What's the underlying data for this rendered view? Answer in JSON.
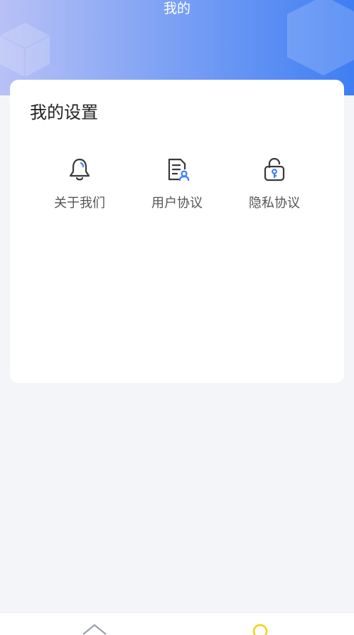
{
  "header": {
    "title": "我的"
  },
  "settings": {
    "title": "我的设置",
    "items": [
      {
        "label": "关于我们",
        "icon": "bell-icon"
      },
      {
        "label": "用户协议",
        "icon": "document-user-icon"
      },
      {
        "label": "隐私协议",
        "icon": "lock-icon"
      }
    ]
  },
  "tabbar": {
    "tabs": [
      {
        "icon": "home-icon"
      },
      {
        "icon": "profile-icon"
      }
    ]
  },
  "colors": {
    "accent_blue": "#3f7ef3",
    "active_tab": "#f5d20a",
    "page_bg": "#f4f5f8"
  }
}
